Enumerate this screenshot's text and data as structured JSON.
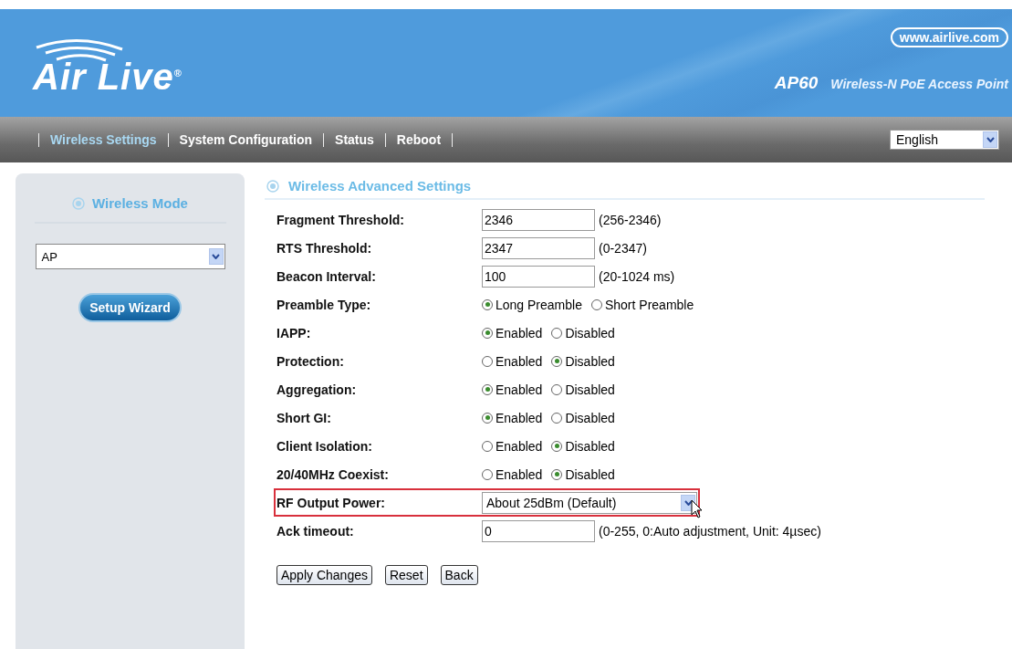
{
  "header": {
    "logo": "Air Live$^{®}$",
    "url": "www.airlive.com",
    "model": "AP60",
    "product": "Wireless-N PoE Access Point"
  },
  "nav": {
    "tabs": [
      {
        "label": "Wireless Settings",
        "selected": true
      },
      {
        "label": "System Configuration",
        "selected": false
      },
      {
        "label": "Status",
        "selected": false
      },
      {
        "label": "Reboot",
        "selected": false
      }
    ],
    "language": "English"
  },
  "sidebar": {
    "title": "Wireless Mode",
    "mode": "AP",
    "button": "Setup Wizard"
  },
  "main": {
    "title": "Wireless Advanced Settings",
    "rows": [
      {
        "kind": "text",
        "label": "Fragment Threshold:",
        "value": "2346",
        "hint": "(256-2346)",
        "highlighted": false
      },
      {
        "kind": "text",
        "label": "RTS Threshold:",
        "value": "2347",
        "hint": "(0-2347)",
        "highlighted": false
      },
      {
        "kind": "text",
        "label": "Beacon Interval:",
        "value": "100",
        "hint": "(20-1024 ms)",
        "highlighted": false
      },
      {
        "kind": "radio",
        "label": "Preamble Type:",
        "options": [
          {
            "label": "Long Preamble",
            "selected": true
          },
          {
            "label": "Short Preamble",
            "selected": false
          }
        ],
        "highlighted": false
      },
      {
        "kind": "radio",
        "label": "IAPP:",
        "options": [
          {
            "label": "Enabled",
            "selected": true
          },
          {
            "label": "Disabled",
            "selected": false
          }
        ],
        "highlighted": false
      },
      {
        "kind": "radio",
        "label": "Protection:",
        "options": [
          {
            "label": "Enabled",
            "selected": false
          },
          {
            "label": "Disabled",
            "selected": true
          }
        ],
        "highlighted": false
      },
      {
        "kind": "radio",
        "label": "Aggregation:",
        "options": [
          {
            "label": "Enabled",
            "selected": true
          },
          {
            "label": "Disabled",
            "selected": false
          }
        ],
        "highlighted": false
      },
      {
        "kind": "radio",
        "label": "Short GI:",
        "options": [
          {
            "label": "Enabled",
            "selected": true
          },
          {
            "label": "Disabled",
            "selected": false
          }
        ],
        "highlighted": false
      },
      {
        "kind": "radio",
        "label": "Client Isolation:",
        "options": [
          {
            "label": "Enabled",
            "selected": false
          },
          {
            "label": "Disabled",
            "selected": true
          }
        ],
        "highlighted": false
      },
      {
        "kind": "radio",
        "label": "20/40MHz Coexist:",
        "options": [
          {
            "label": "Enabled",
            "selected": false
          },
          {
            "label": "Disabled",
            "selected": true
          }
        ],
        "highlighted": false
      },
      {
        "kind": "select",
        "label": "RF Output Power:",
        "value": "About 25dBm (Default)",
        "highlighted": true
      },
      {
        "kind": "text",
        "label": "Ack timeout:",
        "value": "0",
        "hint": "(0-255, 0:Auto adjustment, Unit: 4µsec)",
        "highlighted": false
      }
    ],
    "buttons": [
      "Apply Changes",
      "Reset",
      "Back"
    ]
  }
}
